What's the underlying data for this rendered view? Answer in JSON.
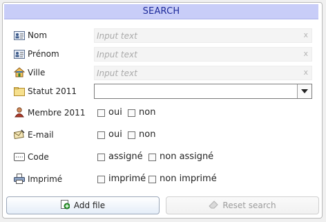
{
  "header": {
    "title": "SEARCH"
  },
  "fields": {
    "nom": {
      "label": "Nom",
      "placeholder": "Input text",
      "clear": "x"
    },
    "prenom": {
      "label": "Prénom",
      "placeholder": "Input text",
      "clear": "x"
    },
    "ville": {
      "label": "Ville",
      "placeholder": "Input text",
      "clear": "x"
    }
  },
  "statut": {
    "label": "Statut 2011",
    "value": ""
  },
  "membre": {
    "label": "Membre 2011",
    "options": [
      "oui",
      "non"
    ]
  },
  "email": {
    "label": "E-mail",
    "options": [
      "oui",
      "non"
    ]
  },
  "code": {
    "label": "Code",
    "options": [
      "assigné",
      "non assigné"
    ]
  },
  "imprime": {
    "label": "Imprimé",
    "options": [
      "imprimé",
      "non imprimé"
    ]
  },
  "buttons": {
    "add": "Add file",
    "reset": "Reset search"
  },
  "colors": {
    "header_bg": "#c8cdf8",
    "header_text": "#1d2a9a"
  }
}
